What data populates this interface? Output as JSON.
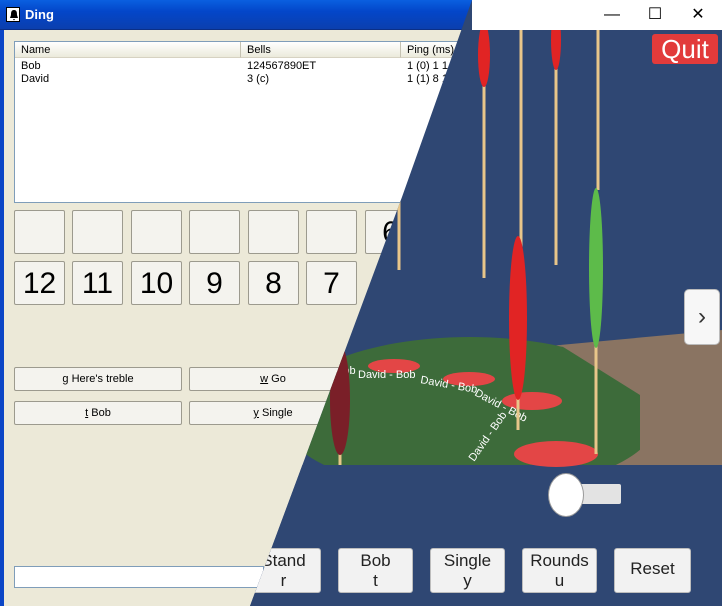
{
  "window": {
    "title": "Ding"
  },
  "list": {
    "columns": [
      "Name",
      "Bells",
      "Ping (ms)"
    ],
    "rows": [
      {
        "name": "Bob",
        "bells": "124567890ET",
        "ping": "1 (0) 1 1"
      },
      {
        "name": "David",
        "bells": "3 (c)",
        "ping": "1 (1) 8 1"
      }
    ]
  },
  "bell_buttons": {
    "top_row": [
      "",
      "",
      "",
      "",
      "",
      "",
      "6"
    ],
    "bottom_row": [
      "12",
      "11",
      "10",
      "9",
      "8",
      "7"
    ]
  },
  "actions": {
    "heres_treble_key": "g",
    "heres_treble_label": " Here's treble",
    "go_key": "w",
    "go_label": " Go",
    "bob_key": "t",
    "bob_label": " Bob",
    "single_key": "y",
    "single_label": " Single"
  },
  "scene": {
    "quit_label": "Quit",
    "next_glyph": "›",
    "caption_minimize": "—",
    "caption_maximize": "☐",
    "caption_close": "✕",
    "mat_labels": [
      "Bob",
      "David - Bob",
      "David - Bob",
      "David - Bob",
      "David - Bob"
    ],
    "rope_colors": {
      "red": "#e12424",
      "green": "#5dbb4a",
      "dark": "#7a1f28"
    },
    "slider_value": 0.0,
    "buttons": [
      {
        "name": "stand",
        "label": "Stand",
        "key": "r"
      },
      {
        "name": "bob",
        "label": "Bob",
        "key": "t"
      },
      {
        "name": "single",
        "label": "Single",
        "key": "y"
      },
      {
        "name": "rounds",
        "label": "Rounds",
        "key": "u"
      },
      {
        "name": "reset",
        "label": "Reset",
        "key": ""
      }
    ]
  }
}
